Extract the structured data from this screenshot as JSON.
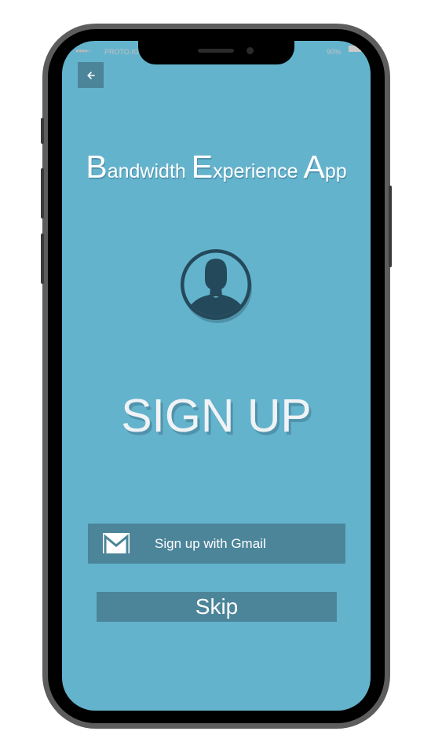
{
  "status_bar": {
    "signal": "●●●●○",
    "carrier": "PROTO.IO",
    "battery_level": "90%"
  },
  "header": {
    "back_icon": "arrow-left-icon"
  },
  "app_title": {
    "word1_initial": "B",
    "word1_rest": "andwidth",
    "word2_initial": "E",
    "word2_rest": "xperience",
    "word3_initial": "A",
    "word3_rest": "pp"
  },
  "avatar": {
    "icon": "user-avatar-icon"
  },
  "heading": "SIGN UP",
  "gmail_button": {
    "label": "Sign up with Gmail",
    "icon": "gmail-icon"
  },
  "skip_button": {
    "label": "Skip"
  },
  "colors": {
    "background": "#64b3cd",
    "button": "#4c8599",
    "avatar": "#24495a",
    "text": "#ffffff"
  }
}
